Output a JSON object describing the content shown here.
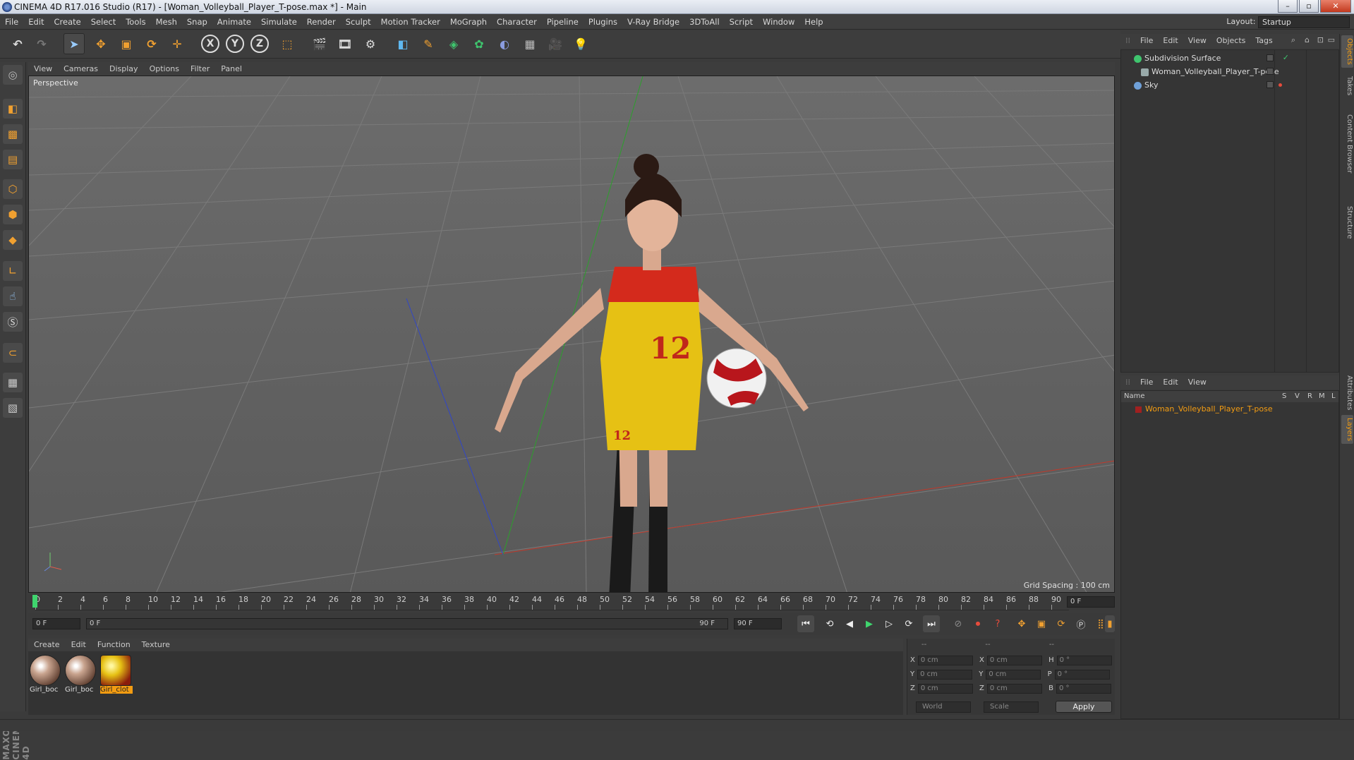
{
  "window": {
    "title": "CINEMA 4D R17.016 Studio (R17) - [Woman_Volleyball_Player_T-pose.max *] - Main",
    "min": "–",
    "max": "▫",
    "close": "✕"
  },
  "menubar": {
    "items": [
      "File",
      "Edit",
      "Create",
      "Select",
      "Tools",
      "Mesh",
      "Snap",
      "Animate",
      "Simulate",
      "Render",
      "Sculpt",
      "Motion Tracker",
      "MoGraph",
      "Character",
      "Pipeline",
      "Plugins",
      "V-Ray Bridge",
      "3DToAll",
      "Script",
      "Window",
      "Help"
    ],
    "layout_label": "Layout:",
    "layout_value": "Startup"
  },
  "toolbar": {
    "axis_x": "X",
    "axis_y": "Y",
    "axis_z": "Z"
  },
  "viewport": {
    "menu": [
      "View",
      "Cameras",
      "Display",
      "Options",
      "Filter",
      "Panel"
    ],
    "label": "Perspective",
    "grid_spacing": "Grid Spacing : 100 cm",
    "shirt_number": "12"
  },
  "timeline": {
    "ticks": [
      "0",
      "2",
      "4",
      "6",
      "8",
      "10",
      "12",
      "14",
      "16",
      "18",
      "20",
      "22",
      "24",
      "26",
      "28",
      "30",
      "32",
      "34",
      "36",
      "38",
      "40",
      "42",
      "44",
      "46",
      "48",
      "50",
      "52",
      "54",
      "56",
      "58",
      "60",
      "62",
      "64",
      "66",
      "68",
      "70",
      "72",
      "74",
      "76",
      "78",
      "80",
      "82",
      "84",
      "86",
      "88",
      "90"
    ],
    "current_frame": "0 F",
    "start_field": "0 F",
    "range_start": "0 F",
    "range_end": "90 F",
    "end_field": "90 F"
  },
  "materials": {
    "menu": [
      "Create",
      "Edit",
      "Function",
      "Texture"
    ],
    "items": [
      {
        "name": "Girl_boc"
      },
      {
        "name": "Girl_boc"
      },
      {
        "name": "Girl_clot"
      }
    ]
  },
  "coords": {
    "header": [
      "--",
      "--",
      "--"
    ],
    "rows": [
      {
        "a": "X",
        "av": "0 cm",
        "b": "X",
        "bv": "0 cm",
        "c": "H",
        "cv": "0 °"
      },
      {
        "a": "Y",
        "av": "0 cm",
        "b": "Y",
        "bv": "0 cm",
        "c": "P",
        "cv": "0 °"
      },
      {
        "a": "Z",
        "av": "0 cm",
        "b": "Z",
        "bv": "0 cm",
        "c": "B",
        "cv": "0 °"
      }
    ],
    "space": "World",
    "mode": "Scale",
    "apply": "Apply"
  },
  "objects": {
    "menu": [
      "File",
      "Edit",
      "View",
      "Objects",
      "Tags"
    ],
    "items": [
      {
        "name": "Subdivision Surface",
        "color": "#3fc56e"
      },
      {
        "name": "Woman_Volleyball_Player_T-pose",
        "color": "#9aa"
      },
      {
        "name": "Sky",
        "color": "#6fa0d8"
      }
    ]
  },
  "layers": {
    "menu": [
      "File",
      "Edit",
      "View"
    ],
    "header_name": "Name",
    "columns": [
      "S",
      "V",
      "R",
      "M",
      "L"
    ],
    "row_name": "Woman_Volleyball_Player_T-pose"
  },
  "side_tabs": [
    "Objects",
    "Takes",
    "Content Browser",
    "Structure",
    "Attributes",
    "Layers"
  ],
  "brand": "MAXON CINEMA 4D"
}
